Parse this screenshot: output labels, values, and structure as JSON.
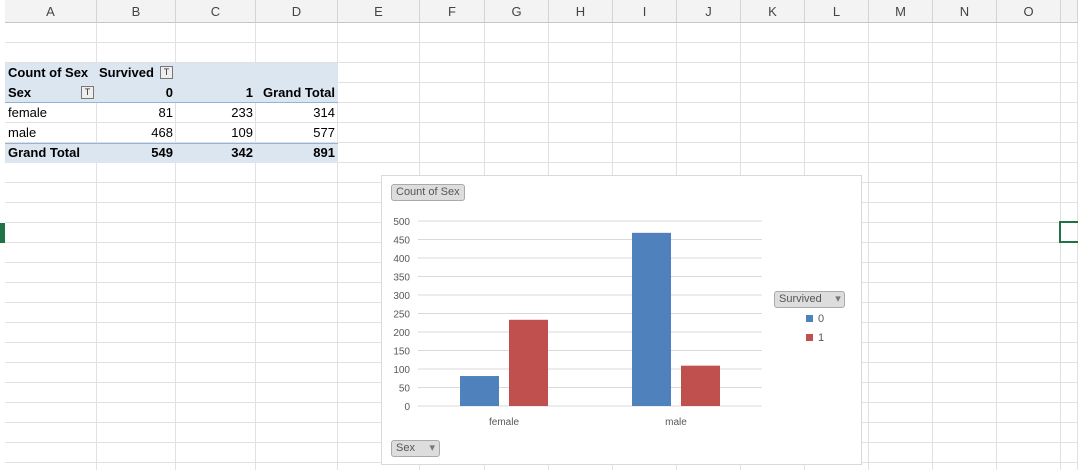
{
  "columns": [
    "A",
    "B",
    "C",
    "D",
    "E",
    "F",
    "G",
    "H",
    "I",
    "J",
    "K",
    "L",
    "M",
    "N",
    "O"
  ],
  "pivot": {
    "title": "Count of Sex",
    "col_field": "Survived",
    "row_field": "Sex",
    "col_headers": [
      "0",
      "1",
      "Grand Total"
    ],
    "rows": [
      {
        "label": "female",
        "values": [
          "81",
          "233",
          "314"
        ]
      },
      {
        "label": "male",
        "values": [
          "468",
          "109",
          "577"
        ]
      }
    ],
    "total": {
      "label": "Grand Total",
      "values": [
        "549",
        "342",
        "891"
      ]
    }
  },
  "chart_data": {
    "type": "bar",
    "title": "Count of Sex",
    "categories": [
      "female",
      "male"
    ],
    "series": [
      {
        "name": "0",
        "values": [
          81,
          468
        ],
        "color": "#4f81bd"
      },
      {
        "name": "1",
        "values": [
          233,
          109
        ],
        "color": "#c0504d"
      }
    ],
    "ylim": [
      0,
      500
    ],
    "yticks": [
      "0",
      "50",
      "100",
      "150",
      "200",
      "250",
      "300",
      "350",
      "400",
      "450",
      "500"
    ],
    "legend_title": "Survived",
    "legend_position": "right",
    "axis_field_button": "Sex",
    "grid": true
  }
}
